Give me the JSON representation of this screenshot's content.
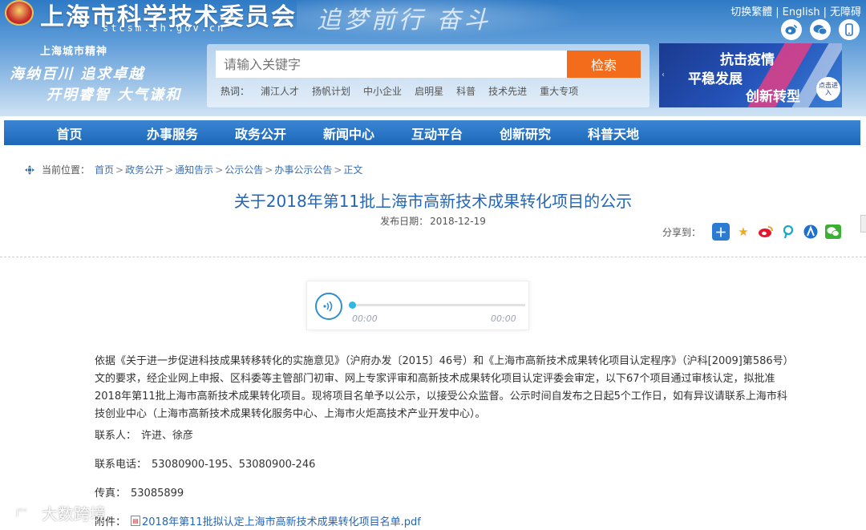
{
  "header": {
    "site_title": "上海市科学技术委员会",
    "site_domain": "stcsm.sh.gov.cn",
    "calligraphy": "追梦前行 奋斗",
    "slogan_head": "上海城市精神",
    "slogan_line1": "海纳百川  追求卓越",
    "slogan_line2": "开明睿智  大气谦和",
    "top_links": [
      "切换繁體",
      "English",
      "无障碍"
    ],
    "top_link_sep": "|",
    "social_icons": [
      "weibo-icon",
      "wechat-icon",
      "mobile-icon"
    ]
  },
  "search": {
    "placeholder": "请输入关键字",
    "button_label": "检索",
    "hot_label": "热词：",
    "hot_words": [
      "浦江人才",
      "扬帆计划",
      "中小企业",
      "启明星",
      "科普",
      "技术先进",
      "重大专项"
    ]
  },
  "banner": {
    "line1": "抗击疫情",
    "line2": "平稳发展",
    "line3": "创新转型",
    "enter_label": "点击进入"
  },
  "nav": {
    "items": [
      "首页",
      "办事服务",
      "政务公开",
      "新闻中心",
      "互动平台",
      "创新研究",
      "科普天地"
    ]
  },
  "breadcrumb": {
    "label": "当前位置：",
    "items": [
      "首页",
      "政务公开",
      "通知告示",
      "公示公告",
      "办事公示公告",
      "正文"
    ],
    "sep": ">"
  },
  "article": {
    "title": "关于2018年第11批上海市高新技术成果转化项目的公示",
    "date_label": "发布日期：",
    "date_value": "2018-12-19",
    "share_label": "分享到："
  },
  "audio": {
    "current": "00:00",
    "total": "00:00",
    "progress": 0
  },
  "body": {
    "paragraph": "依据《关于进一步促进科技成果转移转化的实施意见》（沪府办发〔2015〕46号）和《上海市高新技术成果转化项目认定程序》（沪科[2009]第586号）文的要求，经企业网上申报、区科委等主管部门初审、网上专家评审和高新技术成果转化项目认定评委会审定，以下67个项目通过审核认定，拟批准2018年第11批上海市高新技术成果转化项目。现将项目名单予以公示，以接受公众监督。公示时间自发布之日起5个工作日，如有异议请联系上海市科技创业中心（上海市高新技术成果转化服务中心、上海市火炬高技术产业开发中心）。",
    "contact_label": "联系人：",
    "contact_value": "许进、徐彦",
    "phone_label": "联系电话：",
    "phone_value": "53080900-195、53080900-246",
    "fax_label": "传真：",
    "fax_value": "53085899",
    "attach_label": "附件：",
    "attach_value": "2018年第11批拟认定上海市高新技术成果转化项目名单.pdf"
  },
  "watermark": {
    "text": "大数跨境"
  },
  "colors": {
    "nav_blue": "#1c67b8",
    "title_blue": "#2566b8",
    "search_orange": "#f26c1b"
  }
}
